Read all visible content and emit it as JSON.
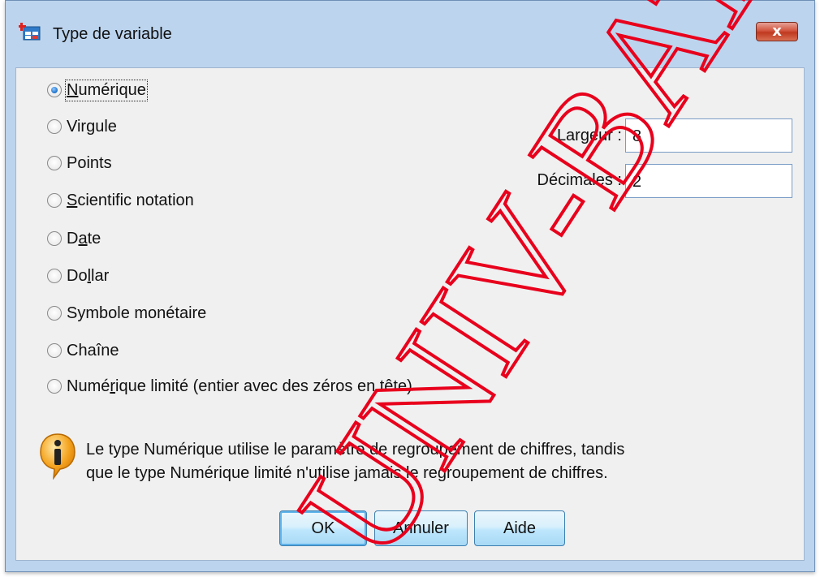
{
  "window": {
    "title": "Type de variable",
    "close_symbol": "x",
    "app_icon": "variable-table-icon"
  },
  "radio_options": [
    {
      "pre": "",
      "ul": "N",
      "post": "umérique",
      "checked": true
    },
    {
      "pre": "Virgule",
      "ul": "",
      "post": "",
      "checked": false
    },
    {
      "pre": "Points",
      "ul": "",
      "post": "",
      "checked": false
    },
    {
      "pre": "",
      "ul": "S",
      "post": "cientific notation",
      "checked": false
    },
    {
      "pre": "D",
      "ul": "a",
      "post": "te",
      "checked": false
    },
    {
      "pre": "Do",
      "ul": "l",
      "post": "lar",
      "checked": false
    },
    {
      "pre": "Symbole monétaire",
      "ul": "",
      "post": "",
      "checked": false
    },
    {
      "pre": "Chaîne",
      "ul": "",
      "post": "",
      "checked": false
    },
    {
      "pre": "Numé",
      "ul": "r",
      "post": "ique limité (entier avec des zéros en tête)",
      "checked": false
    }
  ],
  "fields": {
    "largeur_label": "Largeur :",
    "largeur_value": "8",
    "decimales_label": "Décimales :",
    "decimales_value": "2"
  },
  "info": {
    "icon": "info-icon",
    "line1": "Le type Numérique utilise le paramètre de regroupement de chiffres, tandis",
    "line2": "que le type Numérique limité n'utilise jamais le regroupement de chiffres."
  },
  "buttons": {
    "ok": "OK",
    "cancel": "Annuler",
    "help": "Aide"
  },
  "watermark": {
    "text": "UNIV-BATNA",
    "color": "#e8001c"
  }
}
